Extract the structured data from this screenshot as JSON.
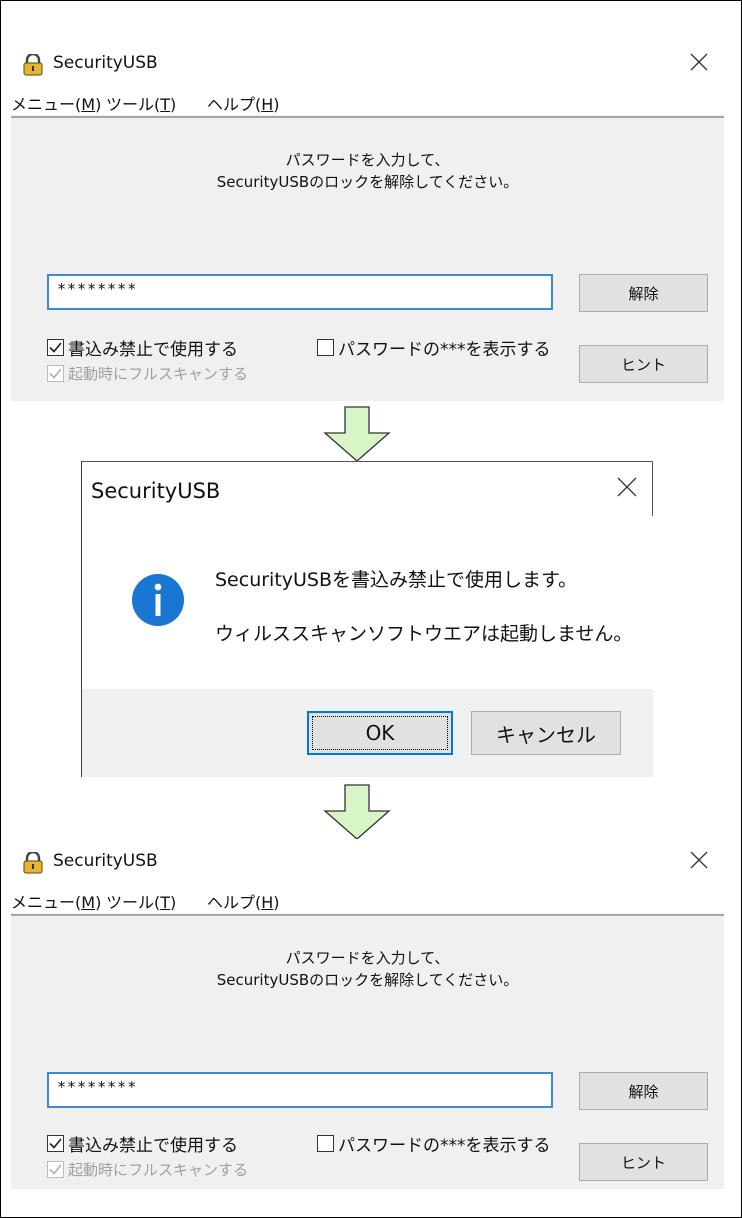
{
  "app_title": "SecurityUSB",
  "menu": {
    "menu_label": "メニュー(",
    "menu_key": "M",
    "tools_label": "ツール(",
    "tools_key": "T",
    "help_label": "ヘルプ(",
    "help_key": "H",
    "close_paren": ")"
  },
  "prompt": {
    "line1": "パスワードを入力して、",
    "line2": "SecurityUSBのロックを解除してください。"
  },
  "password_value": "********",
  "buttons": {
    "unlock": "解除",
    "hint": "ヒント"
  },
  "checkboxes": {
    "write_protect": {
      "label": "書込み禁止で使用する",
      "checked": true
    },
    "show_password": {
      "label": "パスワードの***を表示する",
      "checked": false
    },
    "scan_on_start": {
      "label": "起動時にフルスキャンする",
      "checked": true,
      "disabled": true
    }
  },
  "dialog": {
    "title": "SecurityUSB",
    "message_line1": "SecurityUSBを書込み禁止で使用します。",
    "message_line2": "ウィルススキャンソフトウエアは起動しません。",
    "ok_label": "OK",
    "cancel_label": "キャンセル",
    "icon": "info-icon"
  },
  "colors": {
    "accent": "#0078d7",
    "arrow_fill": "#d8f5c8",
    "dialog_icon": "#1976d2"
  }
}
